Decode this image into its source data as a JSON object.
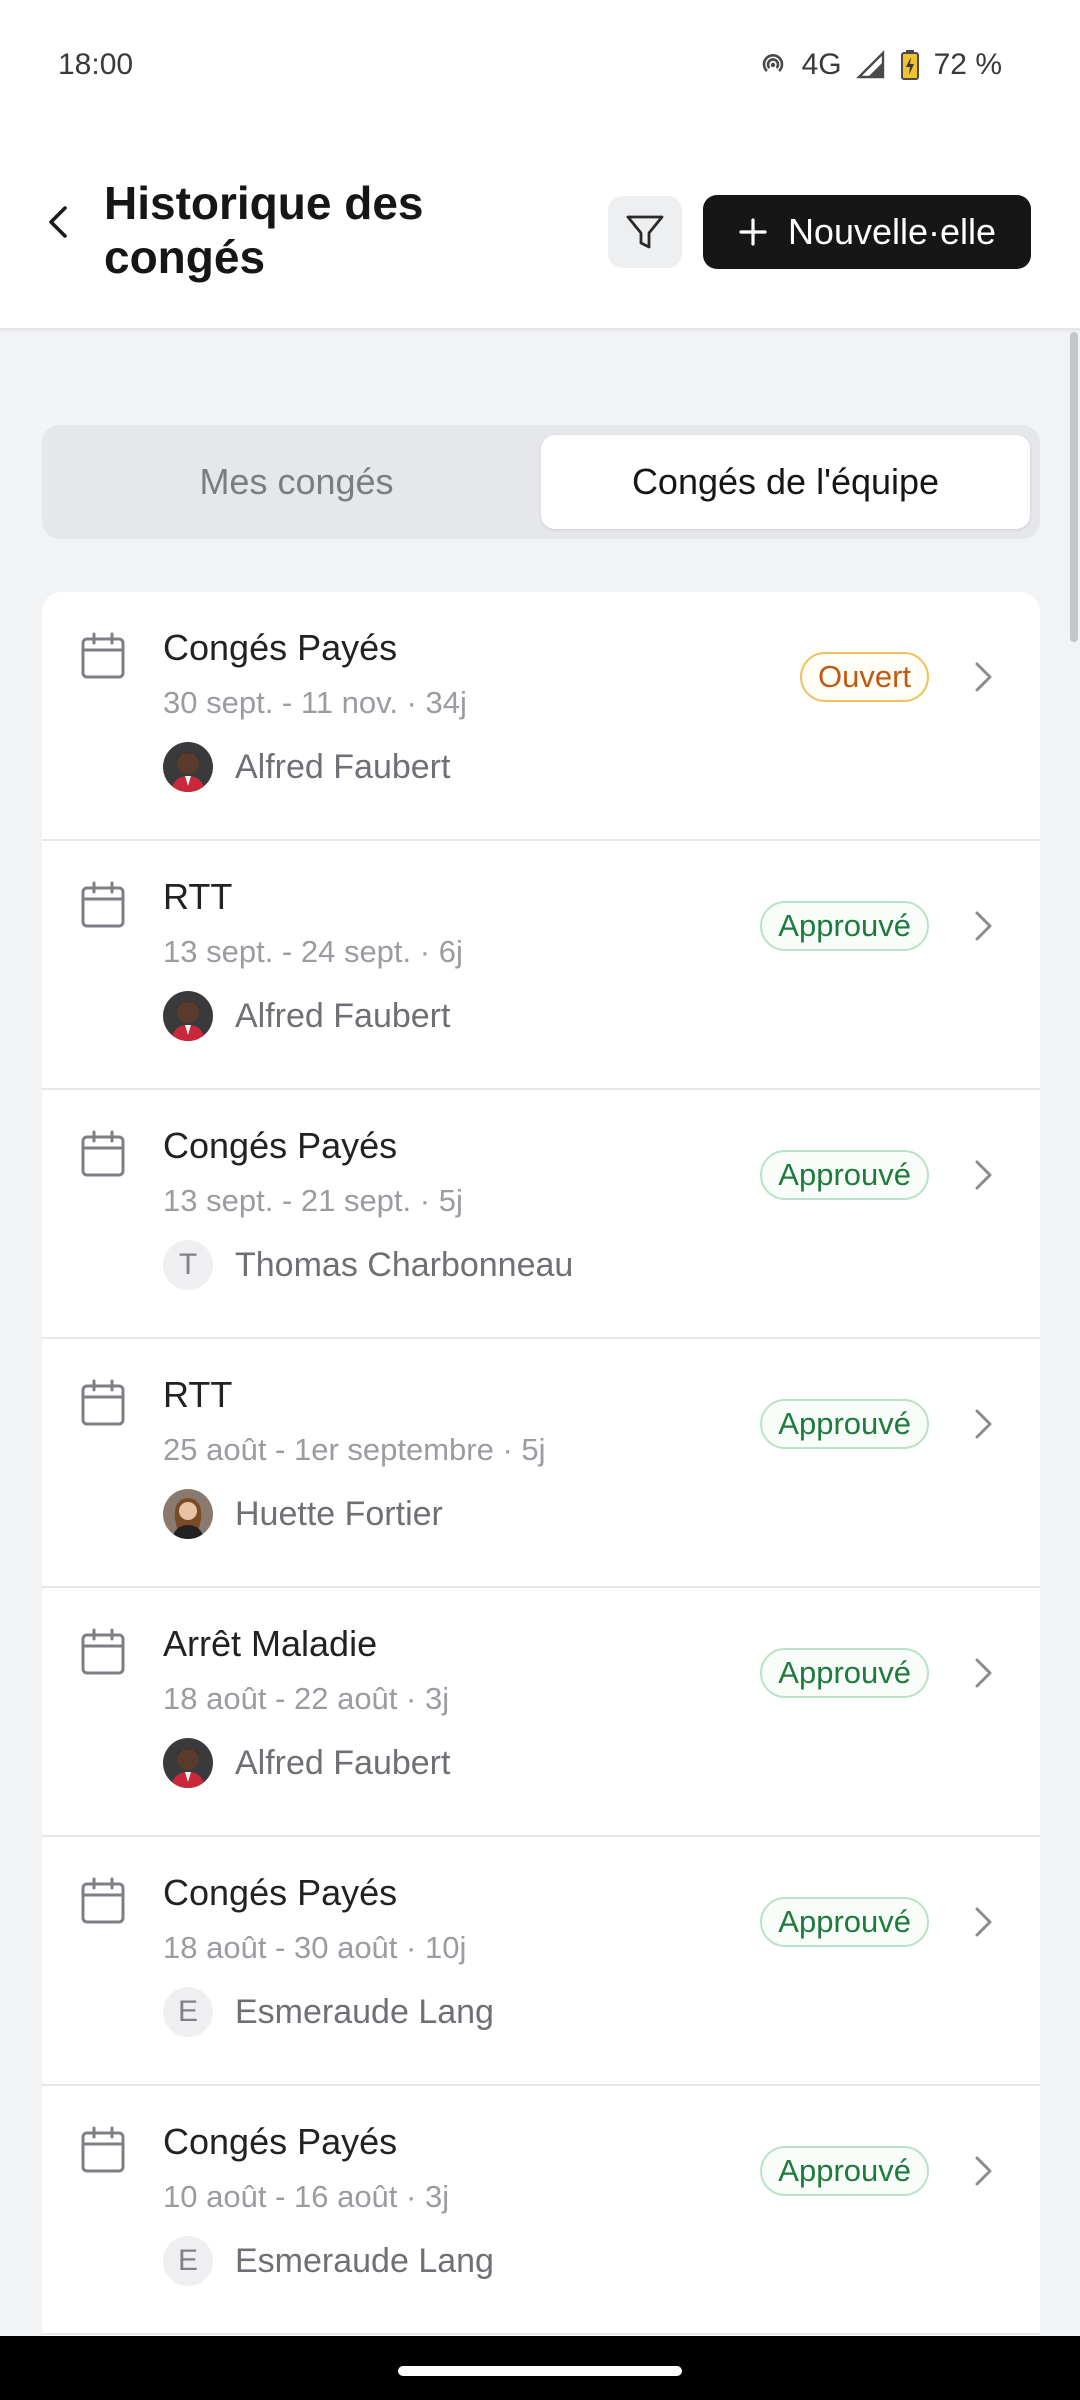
{
  "status_bar": {
    "time": "18:00",
    "network": "4G",
    "battery": "72 %"
  },
  "header": {
    "title": "Historique des congés",
    "new_button_label": "Nouvelle·elle"
  },
  "tabs": [
    {
      "label": "Mes congés",
      "active": false
    },
    {
      "label": "Congés de l'équipe",
      "active": true
    }
  ],
  "leaves": [
    {
      "type": "Congés Payés",
      "dates": "30 sept. - 11 nov. · 34j",
      "person": "Alfred Faubert",
      "avatar": "photo-alfred",
      "status": "Ouvert",
      "status_kind": "open"
    },
    {
      "type": "RTT",
      "dates": "13 sept. - 24 sept. · 6j",
      "person": "Alfred Faubert",
      "avatar": "photo-alfred",
      "status": "Approuvé",
      "status_kind": "approved"
    },
    {
      "type": "Congés Payés",
      "dates": "13 sept. - 21 sept. · 5j",
      "person": "Thomas Charbonneau",
      "avatar_initial": "T",
      "status": "Approuvé",
      "status_kind": "approved"
    },
    {
      "type": "RTT",
      "dates": "25 août - 1er septembre · 5j",
      "person": "Huette Fortier",
      "avatar": "photo-huette",
      "status": "Approuvé",
      "status_kind": "approved"
    },
    {
      "type": "Arrêt Maladie",
      "dates": "18 août - 22 août · 3j",
      "person": "Alfred Faubert",
      "avatar": "photo-alfred",
      "status": "Approuvé",
      "status_kind": "approved"
    },
    {
      "type": "Congés Payés",
      "dates": "18 août - 30 août · 10j",
      "person": "Esmeraude Lang",
      "avatar_initial": "E",
      "status": "Approuvé",
      "status_kind": "approved"
    },
    {
      "type": "Congés Payés",
      "dates": "10 août - 16 août · 3j",
      "person": "Esmeraude Lang",
      "avatar_initial": "E",
      "status": "Approuvé",
      "status_kind": "approved"
    }
  ],
  "colors": {
    "open_text": "#c05a10",
    "open_border": "#f0c15a",
    "approved_text": "#1f7a3e",
    "approved_border": "#b9e2c6",
    "primary_button": "#161616"
  }
}
